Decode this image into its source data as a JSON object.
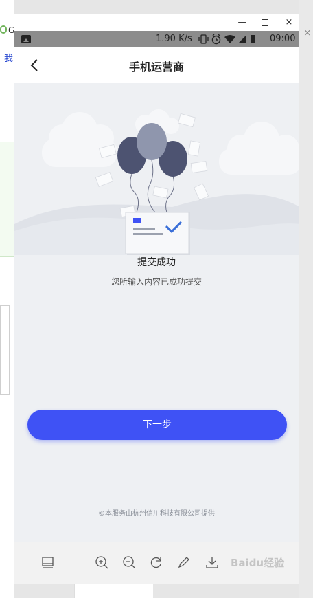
{
  "background": {
    "left_letter": "G",
    "left_link": "我",
    "right_close": "×"
  },
  "window": {
    "title_buttons": {
      "minimize": "—",
      "maximize": "□",
      "close": "×"
    }
  },
  "statusbar": {
    "speed": "1.90 K/s",
    "icons": [
      "image-icon",
      "vibrate-icon",
      "alarm-icon",
      "wifi-icon",
      "signal-icon",
      "battery-icon"
    ],
    "time": "09:00"
  },
  "appbar": {
    "title": "手机运营商"
  },
  "result": {
    "title": "提交成功",
    "subtitle": "您所输入内容已成功提交"
  },
  "actions": {
    "next_label": "下一步"
  },
  "footer": {
    "note": "©本服务由杭州信川科技有限公司提供"
  },
  "toolbar": {
    "tools": [
      "panel-icon",
      "zoom-in-icon",
      "zoom-out-icon",
      "rotate-icon",
      "edit-icon",
      "download-icon"
    ]
  },
  "watermark": "Baidu经验",
  "colors": {
    "accent": "#3f52f5",
    "statusbar": "#8c8c8c",
    "page_bg": "#eef0f3",
    "balloon_dark": "#4d5371",
    "balloon_light": "#8f96ad",
    "check": "#3a6fd8"
  }
}
